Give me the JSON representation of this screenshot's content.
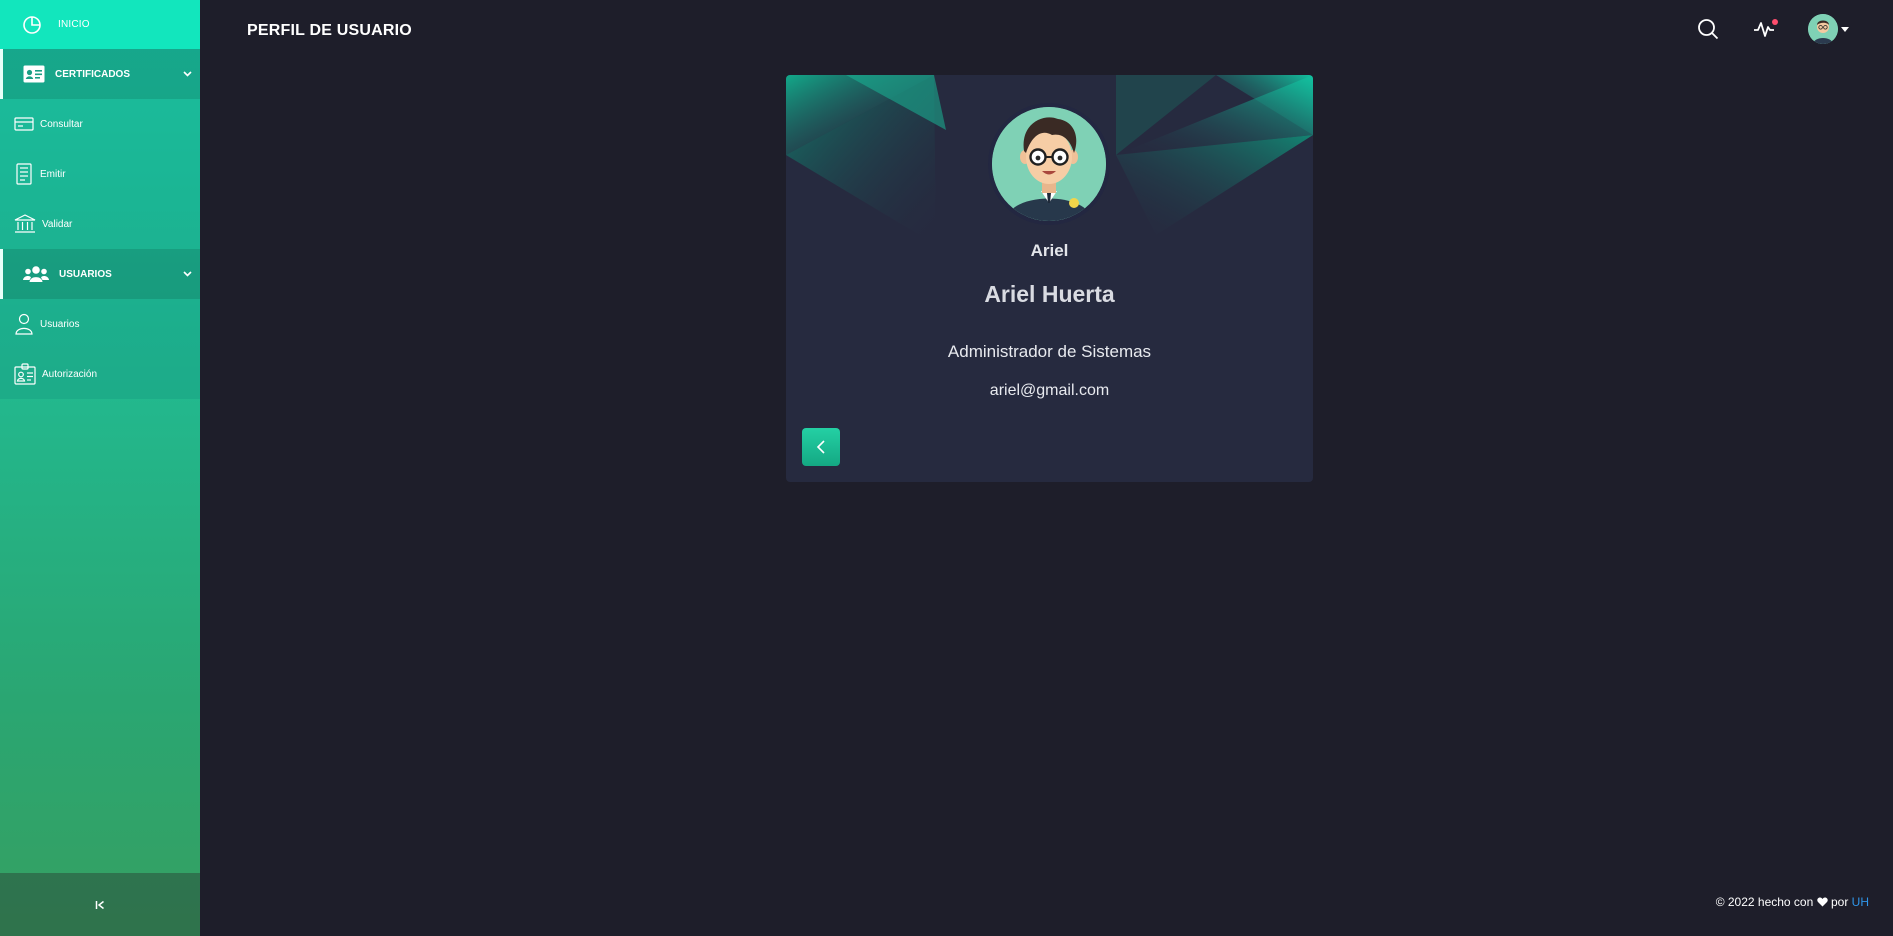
{
  "sidebar": {
    "home_label": "INICIO",
    "sections": [
      {
        "label": "CERTIFICADOS",
        "items": [
          {
            "label": "Consultar",
            "icon": "card-icon"
          },
          {
            "label": "Emitir",
            "icon": "document-icon"
          },
          {
            "label": "Validar",
            "icon": "bank-icon"
          }
        ]
      },
      {
        "label": "USUARIOS",
        "items": [
          {
            "label": "Usuarios",
            "icon": "user-icon"
          },
          {
            "label": "Autorización",
            "icon": "badge-icon"
          }
        ]
      }
    ],
    "collapse_icon": "collapse-left-icon"
  },
  "header": {
    "title": "PERFIL DE USUARIO",
    "icons": [
      "search-icon",
      "activity-icon",
      "avatar"
    ]
  },
  "profile": {
    "username": "Ariel",
    "full_name": "Ariel Huerta",
    "role": "Administrador de Sistemas",
    "email": "ariel@gmail.com"
  },
  "footer": {
    "text": "© 2022 hecho con",
    "by": "por",
    "link": "UH"
  },
  "colors": {
    "accent": "#1ed6b0",
    "background": "#1e1e2a",
    "card": "#262a3f",
    "notification": "#ff4d6d",
    "link": "#2f95e8"
  }
}
